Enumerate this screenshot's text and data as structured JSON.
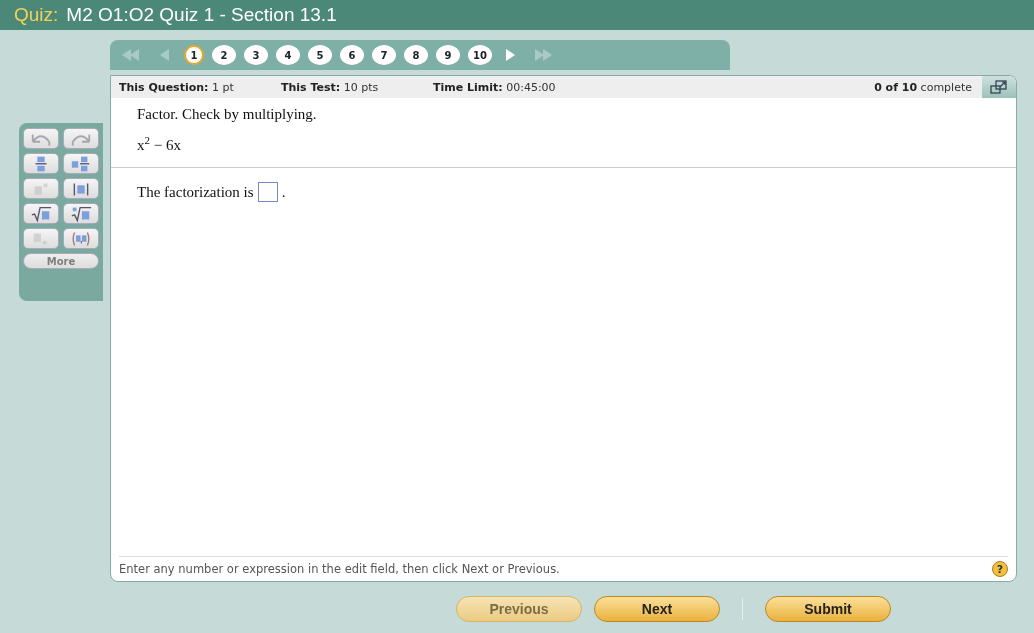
{
  "title": {
    "prefix": "Quiz:",
    "text": "M2 O1:O2 Quiz 1 - Section 13.1"
  },
  "nav": {
    "first_disabled": true,
    "prev_disabled": true,
    "next_disabled": false,
    "last_disabled": true,
    "questions": [
      {
        "label": "1",
        "selected": true
      },
      {
        "label": "2",
        "selected": false
      },
      {
        "label": "3",
        "selected": false
      },
      {
        "label": "4",
        "selected": false
      },
      {
        "label": "5",
        "selected": false
      },
      {
        "label": "6",
        "selected": false
      },
      {
        "label": "7",
        "selected": false
      },
      {
        "label": "8",
        "selected": false
      },
      {
        "label": "9",
        "selected": false
      },
      {
        "label": "10",
        "selected": false
      }
    ]
  },
  "header": {
    "question_label": "This Question:",
    "question_value": "1 pt",
    "test_label": "This Test:",
    "test_value": "10 pts",
    "time_label": "Time Limit:",
    "time_value": "00:45:00",
    "progress": "**0 of 10** complete"
  },
  "tools": [
    {
      "kind": "undo",
      "disabled": true
    },
    {
      "kind": "redo",
      "disabled": true
    },
    {
      "kind": "fraction",
      "disabled": false
    },
    {
      "kind": "mixed",
      "disabled": false
    },
    {
      "kind": "exponent",
      "disabled": true
    },
    {
      "kind": "abs",
      "disabled": false
    },
    {
      "kind": "sqrt",
      "disabled": false
    },
    {
      "kind": "root",
      "disabled": false
    },
    {
      "kind": "subscript",
      "disabled": true
    },
    {
      "kind": "pair",
      "disabled": false
    }
  ],
  "more": {
    "label": "More",
    "disabled": true
  },
  "question": {
    "prompt": "Factor. Check by multiplying.",
    "expression": "x$^{2}$ − 6x",
    "answer_before": "The factorization is",
    "answer_after": "."
  },
  "hint": "Enter any number or expression in the edit field, then click Next or Previous.",
  "help": "?",
  "buttons": [
    {
      "label": "Previous",
      "disabled": true
    },
    {
      "label": "Next",
      "disabled": false
    },
    {
      "label": "Submit",
      "disabled": false
    }
  ]
}
